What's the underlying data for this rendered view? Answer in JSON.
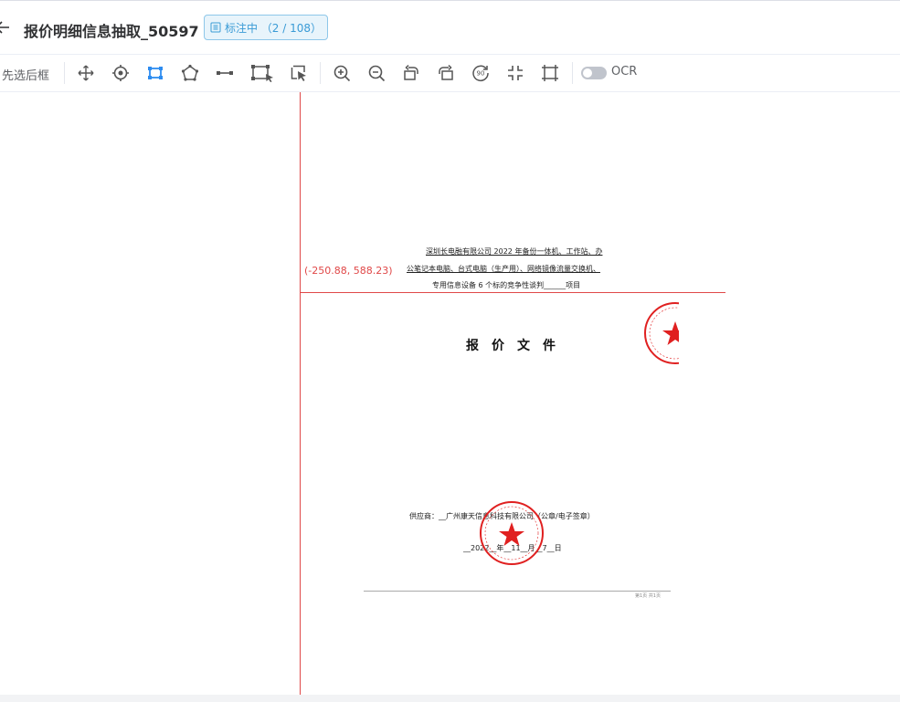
{
  "header": {
    "back_icon": "arrow-left-icon",
    "title": "报价明细信息抽取_50597",
    "status_text": "标注中 （2 / 108）"
  },
  "toolbar": {
    "select_mode_label": "先选后框",
    "tools": [
      {
        "name": "move-icon"
      },
      {
        "name": "point-target-icon"
      },
      {
        "name": "rectangle-tool-icon",
        "active": true
      },
      {
        "name": "polygon-tool-icon"
      },
      {
        "name": "line-tool-icon"
      },
      {
        "name": "box-select-icon"
      },
      {
        "name": "pointer-select-icon"
      },
      {
        "name": "zoom-in-icon"
      },
      {
        "name": "zoom-out-icon"
      },
      {
        "name": "rotate-left-icon"
      },
      {
        "name": "rotate-right-icon"
      },
      {
        "name": "rotate-90-icon"
      },
      {
        "name": "shrink-icon"
      },
      {
        "name": "fit-frame-icon"
      }
    ],
    "ocr_label": "OCR",
    "ocr_enabled": false
  },
  "canvas": {
    "cursor_coord": "(-250.88, 588.23)"
  },
  "document": {
    "heading_lines": [
      "深圳长电融有限公司 2022 年备份一体机、工作站、办",
      "公笔记本电脑、台式电脑（生产用）、网络镜像流量交换机、",
      "专用信息设备 6 个标的竞争性谈判______项目"
    ],
    "title": "报价文件",
    "supplier_line": "供应商：__广州康天信息科技有限公司（公章/电子签章）",
    "date_line": "__2022__年__11__月__7__日",
    "footer": "第1页 共1页"
  },
  "colors": {
    "accent": "#3a9bd6",
    "crosshair": "#e04848",
    "seal": "#e02020"
  }
}
